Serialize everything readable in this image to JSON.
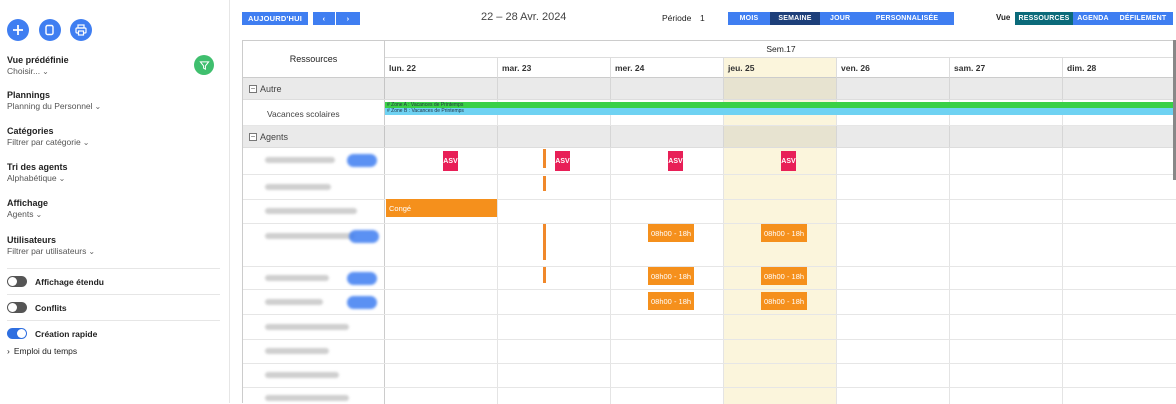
{
  "sidebar": {
    "preset_title": "Vue prédéfinie",
    "preset_value": "Choisir...",
    "plannings_title": "Plannings",
    "plannings_value": "Planning du Personnel",
    "categories_title": "Catégories",
    "categories_value": "Filtrer par catégorie",
    "tri_title": "Tri des agents",
    "tri_value": "Alphabétique",
    "affichage_title": "Affichage",
    "affichage_value": "Agents",
    "users_title": "Utilisateurs",
    "users_value": "Filtrer par utilisateurs",
    "toggles": [
      "Affichage étendu",
      "Conflits",
      "Création rapide"
    ],
    "toggle_states": [
      false,
      false,
      true
    ],
    "emploi": "Emploi du temps",
    "chev": "⌄",
    "arrow": "›"
  },
  "toolbar": {
    "today": "AUJOURD'HUI",
    "prev": "‹",
    "next": "›",
    "date_range": "22 – 28 Avr. 2024",
    "periode_label": "Période",
    "periode_value": "1",
    "periods": [
      "MOIS",
      "SEMAINE",
      "JOUR",
      "PERSONNALISÉE"
    ],
    "active_period": "SEMAINE",
    "vue_label": "Vue",
    "views": [
      "RESSOURCES",
      "AGENDA",
      "DÉFILEMENT"
    ],
    "active_view": "RESSOURCES"
  },
  "calendar": {
    "resources_header": "Ressources",
    "week_label": "Sem.17",
    "days": [
      "lun. 22",
      "mar. 23",
      "mer. 24",
      "jeu. 25",
      "ven. 26",
      "sam. 27",
      "dim. 28"
    ],
    "group_autre": "Autre",
    "group_agents": "Agents",
    "vacances": "Vacances scolaires",
    "zone_a": "# Zone A : Vacances de Printemps",
    "zone_b": "# Zone B : Vacances de Printemps",
    "asv": "ASV",
    "conge": "Congé",
    "shift": "08h00 - 18h",
    "collapse": "−"
  },
  "colors": {
    "accent": "#3f7ef1",
    "today_bg": "#fbf5dc",
    "asv": "#e81f57",
    "orange": "#f5901c",
    "green": "#39d046",
    "sky": "#6fd2f2"
  }
}
